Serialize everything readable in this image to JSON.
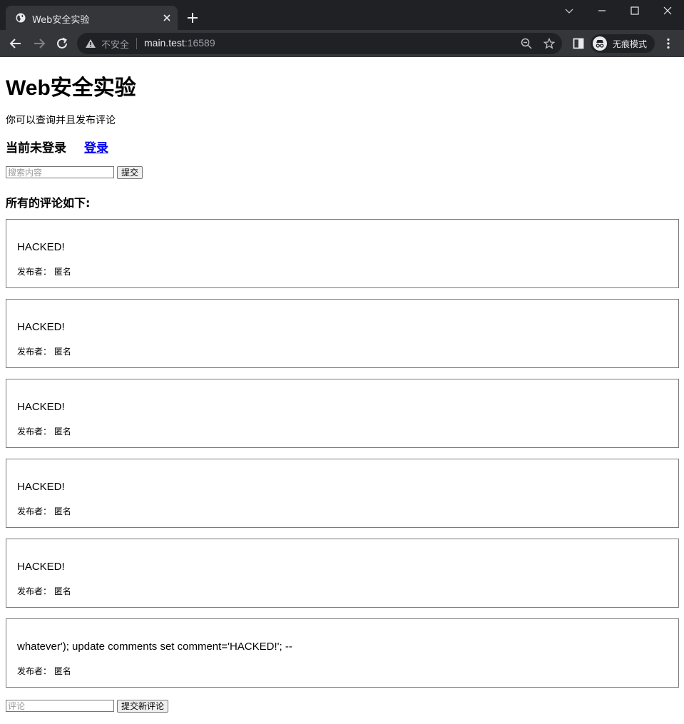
{
  "browser": {
    "tab_title": "Web安全实验",
    "security_label": "不安全",
    "url_host": "main.test",
    "url_port": ":16589",
    "incognito_label": "无痕模式"
  },
  "page": {
    "title": "Web安全实验",
    "intro": "你可以查询并且发布评论",
    "login_status": "当前未登录",
    "login_link": "登录",
    "search": {
      "placeholder": "搜索内容",
      "value": "",
      "button": "提交"
    },
    "comments_heading": "所有的评论如下:",
    "comments": [
      {
        "text": "HACKED!",
        "meta": "发布者：  匿名"
      },
      {
        "text": "HACKED!",
        "meta": "发布者：  匿名"
      },
      {
        "text": "HACKED!",
        "meta": "发布者：  匿名"
      },
      {
        "text": "HACKED!",
        "meta": "发布者：  匿名"
      },
      {
        "text": "HACKED!",
        "meta": "发布者：  匿名"
      },
      {
        "text": "whatever'); update comments set comment='HACKED!'; --",
        "meta": "发布者：  匿名"
      }
    ],
    "new_comment": {
      "placeholder": "评论",
      "value": "",
      "button": "提交新评论"
    }
  }
}
